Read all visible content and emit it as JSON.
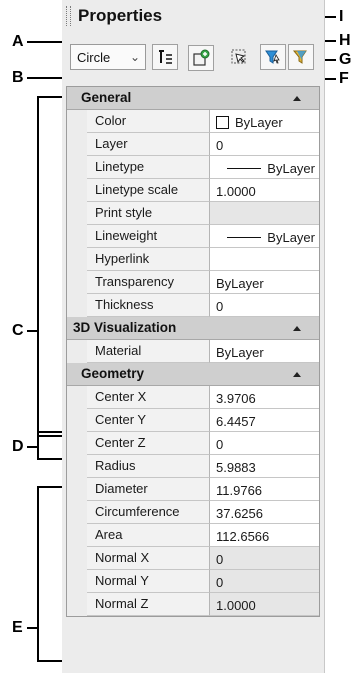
{
  "callouts": {
    "A": "A",
    "B": "B",
    "C": "C",
    "D": "D",
    "E": "E",
    "F": "F",
    "G": "G",
    "H": "H",
    "I": "I"
  },
  "palette": {
    "title": "Properties",
    "object_select": {
      "value": "Circle"
    },
    "toolbar_icons": [
      "toggle-pickadd-icon",
      "select-objects-icon",
      "quick-select-icon",
      "filter-icon",
      "filter-options-icon"
    ]
  },
  "sections": {
    "general": {
      "title": "General",
      "rows": [
        {
          "label": "Color",
          "value": "ByLayer"
        },
        {
          "label": "Layer",
          "value": "0"
        },
        {
          "label": "Linetype",
          "value": "ByLayer"
        },
        {
          "label": "Linetype scale",
          "value": "1.0000"
        },
        {
          "label": "Print style",
          "value": ""
        },
        {
          "label": "Lineweight",
          "value": "ByLayer"
        },
        {
          "label": "Hyperlink",
          "value": ""
        },
        {
          "label": "Transparency",
          "value": "ByLayer"
        },
        {
          "label": "Thickness",
          "value": "0"
        }
      ]
    },
    "visualization": {
      "title": "3D Visualization",
      "rows": [
        {
          "label": "Material",
          "value": "ByLayer"
        }
      ]
    },
    "geometry": {
      "title": "Geometry",
      "rows": [
        {
          "label": "Center X",
          "value": "3.9706"
        },
        {
          "label": "Center Y",
          "value": "6.4457"
        },
        {
          "label": "Center Z",
          "value": "0"
        },
        {
          "label": "Radius",
          "value": "5.9883"
        },
        {
          "label": "Diameter",
          "value": "11.9766"
        },
        {
          "label": "Circumference",
          "value": "37.6256"
        },
        {
          "label": "Area",
          "value": "112.6566"
        },
        {
          "label": "Normal X",
          "value": "0"
        },
        {
          "label": "Normal Y",
          "value": "0"
        },
        {
          "label": "Normal Z",
          "value": "1.0000"
        }
      ]
    }
  }
}
